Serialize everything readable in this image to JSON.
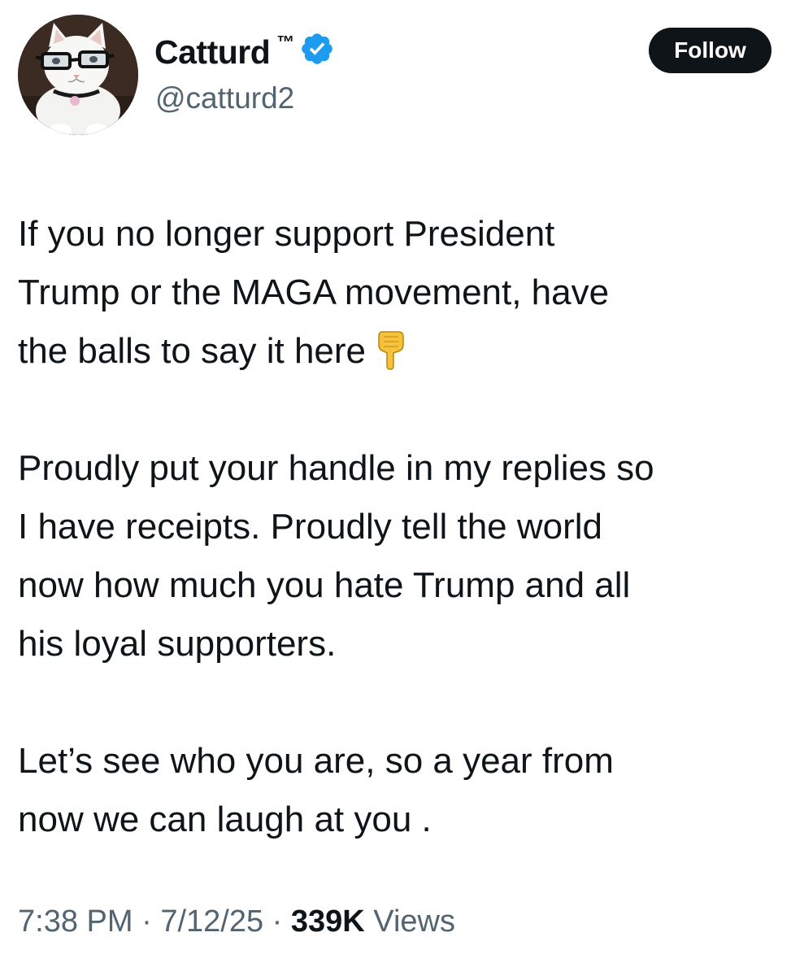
{
  "author": {
    "display_name": "Catturd",
    "trademark": "™",
    "handle": "@catturd2",
    "avatar_icon": "cat-with-glasses-avatar",
    "verified_icon": "verified-badge-icon",
    "verified_color": "#1d9bf0"
  },
  "follow_button": {
    "label": "Follow"
  },
  "tweet": {
    "paragraphs": [
      {
        "lines": [
          "If you no longer support President",
          "Trump or the MAGA movement, have",
          "the balls to say it here"
        ],
        "trailing_emoji": "backhand-index-pointing-down"
      },
      {
        "lines": [
          "Proudly put your handle in my replies so",
          "I have receipts. Proudly tell the world",
          "now how much you hate Trump and all",
          "his loyal supporters."
        ]
      },
      {
        "lines": [
          "Let’s see who you are, so a year from",
          "now we can laugh at you ."
        ]
      }
    ]
  },
  "meta": {
    "time": "7:38 PM",
    "separator": " · ",
    "date": "7/12/25",
    "views_count": "339K",
    "views_label": " Views"
  },
  "colors": {
    "text_primary": "#0f1419",
    "text_secondary": "#536471",
    "button_bg": "#0f1419",
    "button_text": "#ffffff"
  }
}
